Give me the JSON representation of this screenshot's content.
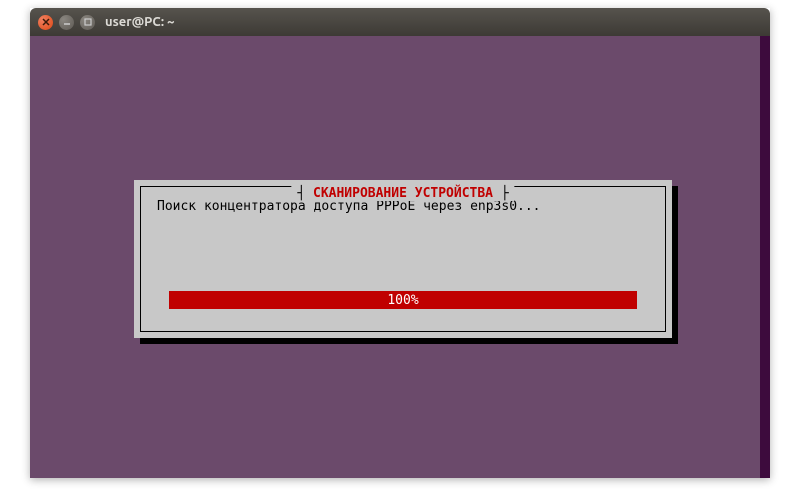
{
  "window": {
    "title": "user@PC: ~"
  },
  "dialog": {
    "title": "СКАНИРОВАНИЕ УСТРОЙСТВА",
    "message": "Поиск концентратора доступа PPPoE через enp3s0...",
    "progress_percent": "100%"
  }
}
